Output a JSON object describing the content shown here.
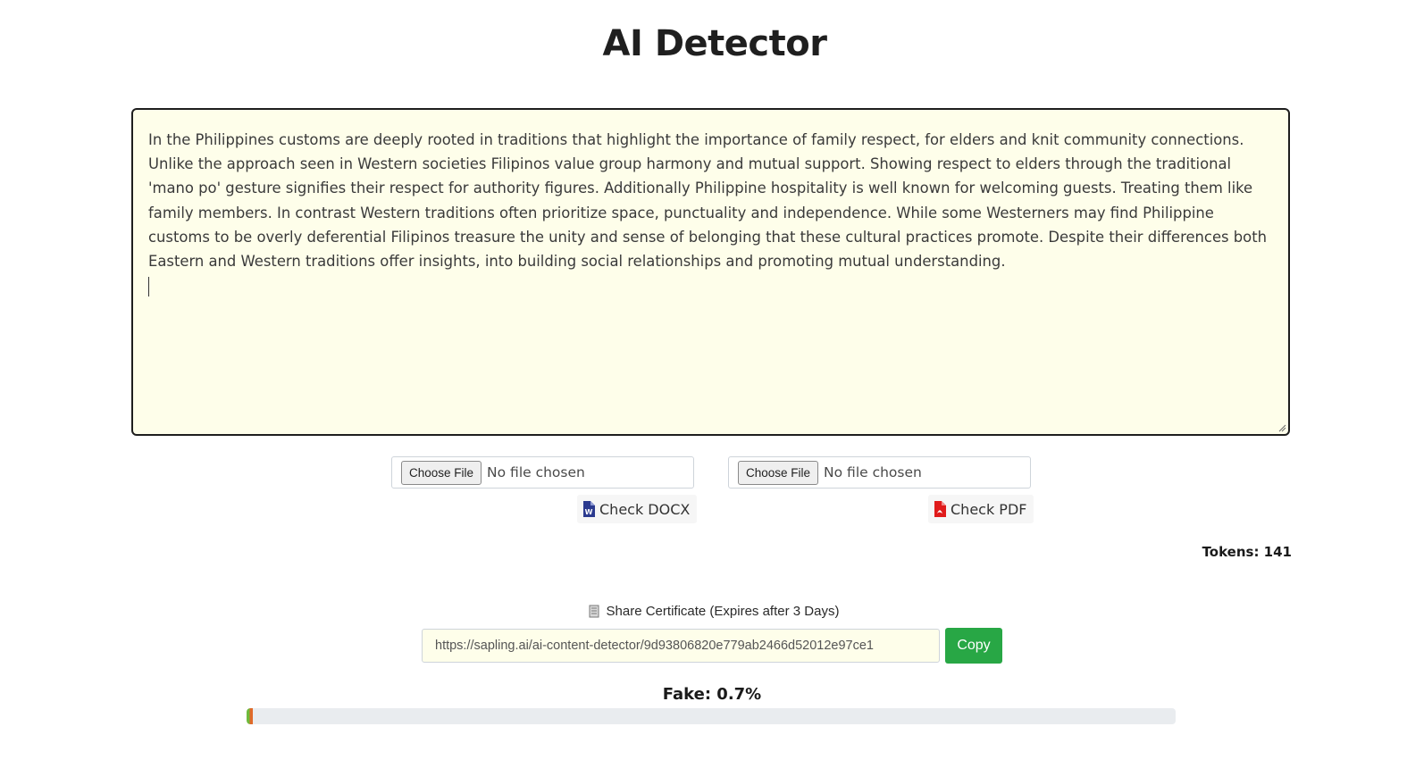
{
  "page": {
    "title": "AI Detector"
  },
  "editor": {
    "text": "In the Philippines customs are deeply rooted in traditions that highlight the importance of family respect, for elders and knit community connections. Unlike the approach seen in Western societies Filipinos value group harmony and mutual support. Showing respect to elders through the traditional 'mano po' gesture signifies their respect for authority figures. Additionally Philippine hospitality is well known for welcoming guests. Treating them like family members. In contrast Western traditions often prioritize space, punctuality and independence. While some Westerners may find Philippine customs to be overly deferential Filipinos treasure the unity and sense of belonging that these cultural practices promote. Despite their differences both Eastern and Western traditions offer insights, into building social relationships and promoting mutual understanding."
  },
  "uploads": {
    "docx": {
      "choose_label": "Choose File",
      "status": "No file chosen",
      "check_label": "Check DOCX",
      "icon": "word-file-icon",
      "icon_color": "#2b3a8f"
    },
    "pdf": {
      "choose_label": "Choose File",
      "status": "No file chosen",
      "check_label": "Check PDF",
      "icon": "pdf-file-icon",
      "icon_color": "#e01b1b"
    }
  },
  "tokens": {
    "label": "Tokens: 141"
  },
  "share": {
    "icon": "certificate-icon",
    "label": "Share Certificate (Expires after 3 Days)",
    "url": "https://sapling.ai/ai-content-detector/9d93806820e779ab2466d52012e97ce1",
    "copy_label": "Copy",
    "copy_color": "#28a745"
  },
  "result": {
    "label": "Fake: 0.7%",
    "fake_percent": 0.7
  }
}
